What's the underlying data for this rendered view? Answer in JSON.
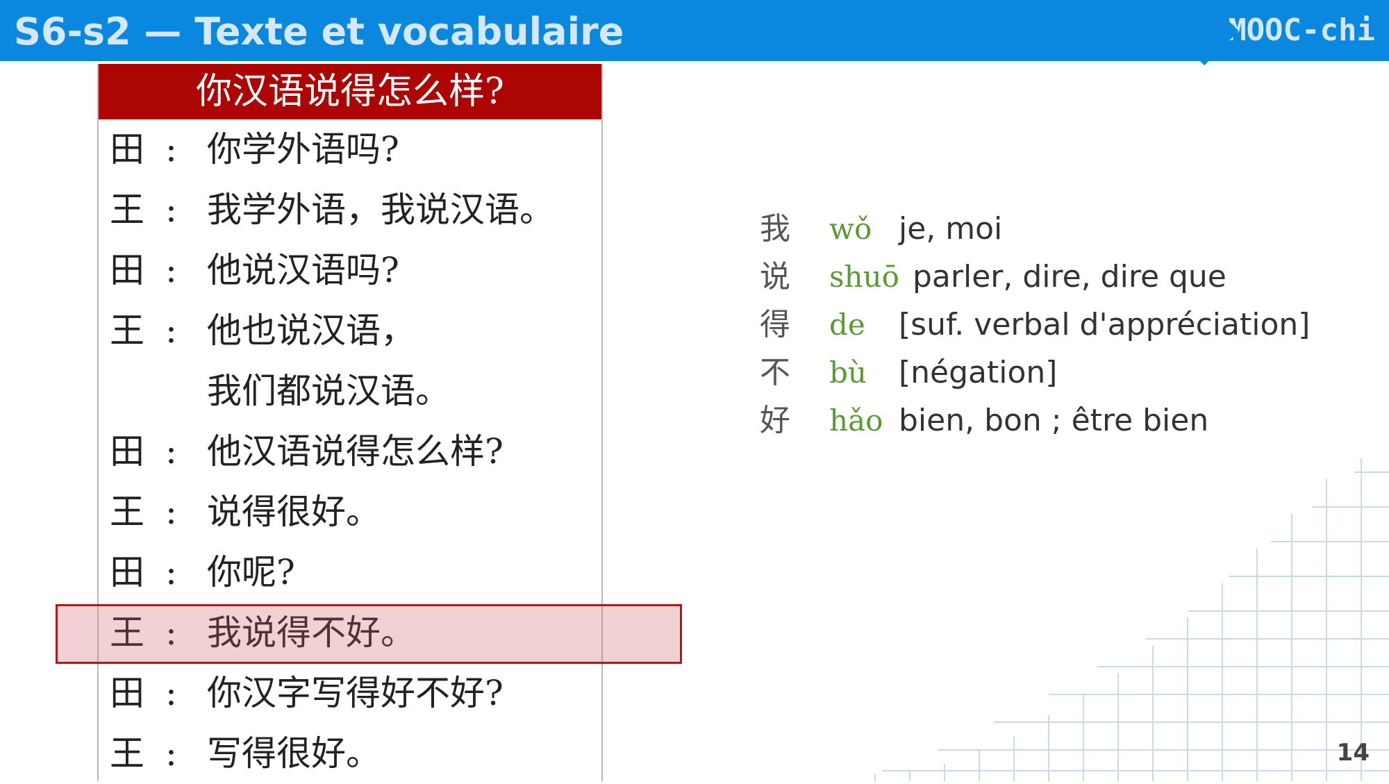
{
  "header": {
    "title": "S6-s2 — Texte et vocabulaire",
    "brand": "MOOC-chi"
  },
  "dialogue": {
    "title": "你汉语说得怎么样?",
    "lines": [
      {
        "speaker": "田",
        "colon": ":",
        "text": "你学外语吗?"
      },
      {
        "speaker": "王",
        "colon": ":",
        "text": "我学外语，我说汉语。"
      },
      {
        "speaker": "田",
        "colon": ":",
        "text": "他说汉语吗?"
      },
      {
        "speaker": "王",
        "colon": ":",
        "text": "他也说汉语，"
      },
      {
        "speaker": "",
        "colon": "",
        "text": "我们都说汉语。"
      },
      {
        "speaker": "田",
        "colon": ":",
        "text": "他汉语说得怎么样?"
      },
      {
        "speaker": "王",
        "colon": ":",
        "text": "说得很好。"
      },
      {
        "speaker": "田",
        "colon": ":",
        "text": "你呢?"
      },
      {
        "speaker": "王",
        "colon": ":",
        "text": "我说得不好。"
      },
      {
        "speaker": "田",
        "colon": ":",
        "text": "你汉字写得好不好?"
      },
      {
        "speaker": "王",
        "colon": ":",
        "text": "写得很好。"
      }
    ],
    "highlighted_line": 8
  },
  "vocabulary": [
    {
      "char": "我",
      "pinyin": "wǒ",
      "meaning": "je, moi"
    },
    {
      "char": "说",
      "pinyin": "shuō",
      "meaning": "parler, dire, dire que"
    },
    {
      "char": "得",
      "pinyin": "de",
      "meaning": "[suf. verbal d'appréciation]"
    },
    {
      "char": "不",
      "pinyin": "bù",
      "meaning": "[négation]"
    },
    {
      "char": "好",
      "pinyin": "hǎo",
      "meaning": "bien, bon ; être bien"
    }
  ],
  "page_number": "14",
  "colors": {
    "header_blue": "#0a88e0",
    "title_red": "#ad0404",
    "pinyin_green": "#5a9a32",
    "highlight_border": "#b5141c"
  }
}
